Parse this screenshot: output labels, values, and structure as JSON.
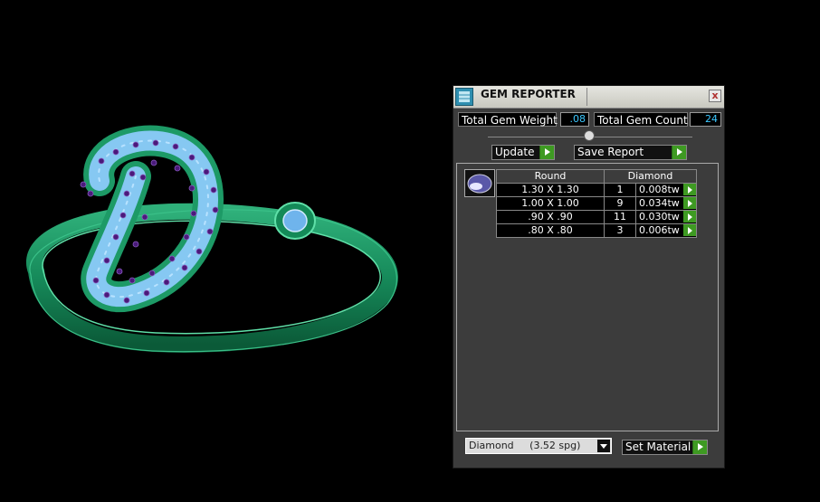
{
  "window": {
    "title": "GEM REPORTER",
    "close_label": "x"
  },
  "summary": {
    "total_weight_label": "Total Gem Weight",
    "total_weight_value": ".08",
    "total_count_label": "Total Gem Count",
    "total_count_value": "24"
  },
  "actions": {
    "update_label": "Update",
    "save_report_label": "Save Report"
  },
  "table": {
    "headers": [
      "Round",
      "Diamond"
    ],
    "rows": [
      {
        "size": "1.30 X 1.30",
        "count": "1",
        "weight": "0.008tw"
      },
      {
        "size": "1.00 X 1.00",
        "count": "9",
        "weight": "0.034tw"
      },
      {
        "size": ".90 X .90",
        "count": "11",
        "weight": "0.030tw"
      },
      {
        "size": ".80 X .80",
        "count": "3",
        "weight": "0.006tw"
      }
    ]
  },
  "material": {
    "selected": "Diamond     (3.52 spg)",
    "set_label": "Set Material"
  },
  "colors": {
    "accent_green": "#3e9a22",
    "value_cyan": "#3cc8ff",
    "ring_green": "#1f8f5f",
    "gem_blue": "#7ab8f0",
    "prong_purple": "#4a1a7a"
  },
  "icons": {
    "app": "gem-reporter-app-icon",
    "gem_shape": "round-gem-icon",
    "close": "close-icon",
    "run": "play-arrow-icon",
    "dropdown": "chevron-down-icon"
  }
}
